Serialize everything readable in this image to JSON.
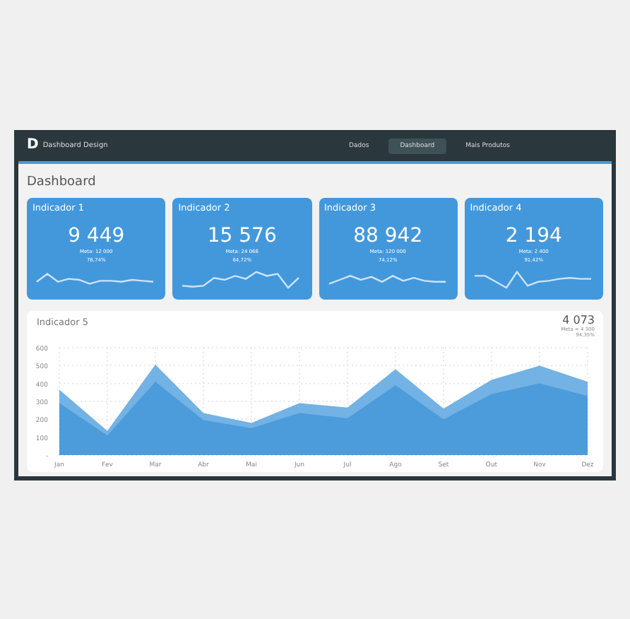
{
  "app": {
    "logo": "D",
    "title": "Dashboard Design"
  },
  "nav": [
    {
      "label": "Dados",
      "selected": false
    },
    {
      "label": "Dashboard",
      "selected": true
    },
    {
      "label": "Mais Produtos",
      "selected": false
    }
  ],
  "page_title": "Dashboard",
  "indicators": [
    {
      "title": "Indicador 1",
      "value": "9 449",
      "goal": "Meta: 12 000",
      "percent": "78,74%"
    },
    {
      "title": "Indicador 2",
      "value": "15 576",
      "goal": "Meta: 24 066",
      "percent": "64,72%"
    },
    {
      "title": "Indicador 3",
      "value": "88 942",
      "goal": "Meta: 120 000",
      "percent": "74,12%"
    },
    {
      "title": "Indicador 4",
      "value": "2 194",
      "goal": "Meta: 2 400",
      "percent": "91,42%"
    }
  ],
  "main_indicator": {
    "title": "Indicador 5",
    "value": "4 073",
    "goal": "Meta = 4 300",
    "percent": "94,35%",
    "chart_data": {
      "type": "area",
      "categories": [
        "Jan",
        "Fev",
        "Mar",
        "Abr",
        "Mai",
        "Jun",
        "Jul",
        "Ago",
        "Set",
        "Out",
        "Nov",
        "Dez"
      ],
      "grid": true,
      "series": [
        {
          "color": "#72b2e4",
          "values": [
            365,
            135,
            505,
            235,
            180,
            290,
            265,
            480,
            260,
            420,
            500,
            410
          ]
        },
        {
          "color": "#4c9bdb",
          "values": [
            290,
            110,
            410,
            195,
            150,
            235,
            205,
            390,
            200,
            340,
            400,
            330
          ]
        }
      ],
      "ylim": [
        0,
        600
      ],
      "yticks": [
        {
          "value": 0,
          "label": "-"
        },
        100,
        200,
        300,
        400,
        500,
        600
      ]
    }
  }
}
